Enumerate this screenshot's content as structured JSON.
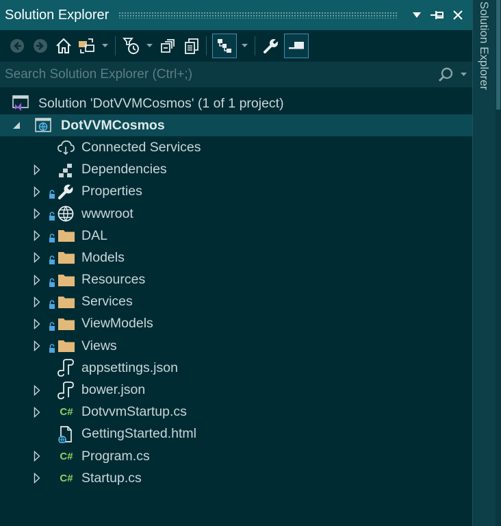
{
  "window": {
    "title": "Solution Explorer",
    "side_tab_label": "Solution Explorer"
  },
  "search": {
    "placeholder": "Search Solution Explorer (Ctrl+;)"
  },
  "colors": {
    "titlebar": "#0f5b66",
    "background": "#012b33",
    "selection": "#0c4a55",
    "folder": "#e3b97a",
    "csharp": "#8dd35f",
    "solution_icon": "#9b5fe0"
  },
  "toolbar": {
    "buttons": [
      "back-icon",
      "forward-icon",
      "home-icon",
      "switch-views-icon",
      "pending-changes-filter-icon",
      "collapse-all-icon",
      "show-all-files-icon",
      "sync-with-document-icon",
      "properties-icon",
      "preview-selected-items-icon"
    ]
  },
  "tree": {
    "solution": "Solution 'DotVVMCosmos' (1 of 1 project)",
    "project": "DotVVMCosmos",
    "items": [
      {
        "label": "Connected Services",
        "icon": "cloud-icon"
      },
      {
        "label": "Dependencies",
        "icon": "dependencies-icon"
      },
      {
        "label": "Properties",
        "icon": "wrench-icon"
      },
      {
        "label": "wwwroot",
        "icon": "globe-icon"
      },
      {
        "label": "DAL",
        "icon": "folder-icon"
      },
      {
        "label": "Models",
        "icon": "folder-icon"
      },
      {
        "label": "Resources",
        "icon": "folder-icon"
      },
      {
        "label": "Services",
        "icon": "folder-icon"
      },
      {
        "label": "ViewModels",
        "icon": "folder-icon"
      },
      {
        "label": "Views",
        "icon": "folder-icon"
      },
      {
        "label": "appsettings.json",
        "icon": "json-file-icon"
      },
      {
        "label": "bower.json",
        "icon": "json-file-icon"
      },
      {
        "label": "DotvvmStartup.cs",
        "icon": "csharp-file-icon",
        "glyph": "C#"
      },
      {
        "label": "GettingStarted.html",
        "icon": "html-file-icon"
      },
      {
        "label": "Program.cs",
        "icon": "csharp-file-icon",
        "glyph": "C#"
      },
      {
        "label": "Startup.cs",
        "icon": "csharp-file-icon",
        "glyph": "C#"
      }
    ]
  }
}
